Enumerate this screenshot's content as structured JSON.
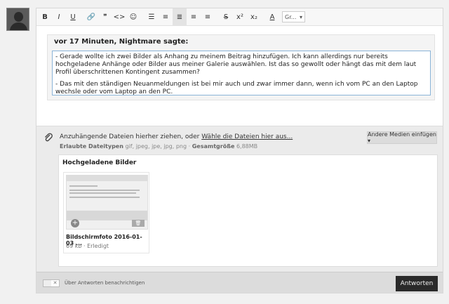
{
  "toolbar": {
    "buttons": [
      "B",
      "I",
      "U",
      "🔗",
      "❞",
      "<>",
      "☺",
      "☰",
      "≡",
      "≣",
      "≡",
      "≡",
      "S",
      "x²",
      "x₂",
      "A"
    ],
    "font_select": "Gr...",
    "chevron": "▾"
  },
  "quote": {
    "header": "vor 17 Minuten, Nightmare sagte:",
    "para1": "- Gerade wollte ich zwei Bilder als Anhang zu meinem Beitrag hinzufügen. Ich kann allerdings nur bereits hochgeladene Anhänge oder Bilder aus meiner Galerie auswählen. Ist das so gewollt oder hängt das mit dem laut Profil überschrittenen Kontingent zusammen?",
    "para2": "- Das mit den ständigen Neuanmeldungen ist bei mir auch und zwar immer dann, wenn ich vom PC an den Laptop wechsle oder vom Laptop an den PC."
  },
  "attach": {
    "title_prefix": "Anzuhängende Dateien hierher ziehen, oder ",
    "title_link": "Wähle die Dateien hier aus...",
    "types_label": "Erlaubte Dateitypen",
    "types_value": "gif, jpeg, jpe, jpg, png",
    "separator": "·",
    "total_label": "Gesamtgröße",
    "total_value": "6,88MB",
    "media_button": "Andere Medien einfügen ▾"
  },
  "uploaded": {
    "title": "Hochgeladene Bilder",
    "item": {
      "name": "Bildschirmfoto 2016-01-03 ...",
      "info": "69 kb · Erledigt"
    }
  },
  "footer": {
    "notify_label": "Über Antworten benachrichtigen",
    "reply_button": "Antworten",
    "toggle_x": "✕"
  }
}
